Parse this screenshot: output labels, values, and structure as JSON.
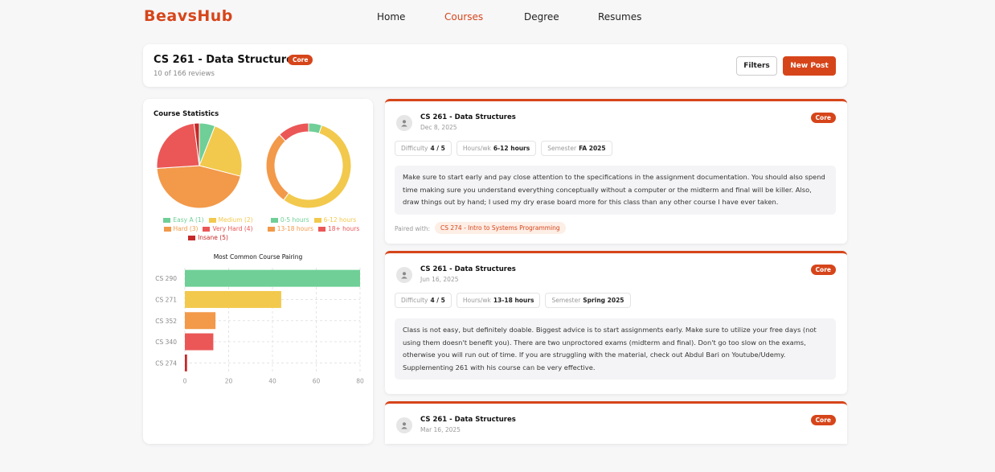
{
  "nav": {
    "brand": "BeavsHub",
    "links": [
      "Home",
      "Courses",
      "Degree",
      "Resumes"
    ],
    "active": "Courses"
  },
  "header": {
    "course_title": "CS 261 - Data Structures",
    "tag": "Core",
    "reviews_count": "10 of 166 reviews",
    "filters_label": "Filters",
    "new_post_label": "New Post"
  },
  "stats": {
    "title": "Course Statistics",
    "difficulty_legend": [
      {
        "label": "Easy A (1)",
        "color": "#6fcf97"
      },
      {
        "label": "Medium (2)",
        "color": "#f2c94c"
      },
      {
        "label": "Hard (3)",
        "color": "#f2994a"
      },
      {
        "label": "Very Hard (4)",
        "color": "#eb5757"
      },
      {
        "label": "Insane (5)",
        "color": "#c62828"
      }
    ],
    "hours_legend": [
      {
        "label": "0-5 hours",
        "color": "#6fcf97"
      },
      {
        "label": "6-12 hours",
        "color": "#f2c94c"
      },
      {
        "label": "13-18 hours",
        "color": "#f2994a"
      },
      {
        "label": "18+ hours",
        "color": "#eb5757"
      }
    ],
    "pairing_title": "Most Common Course Pairing"
  },
  "chart_data": [
    {
      "type": "pie",
      "categories": [
        "Easy A (1)",
        "Medium (2)",
        "Hard (3)",
        "Very Hard (4)",
        "Insane (5)"
      ],
      "values": [
        6,
        23,
        45,
        24,
        2
      ],
      "colors": [
        "#6fcf97",
        "#f2c94c",
        "#f2994a",
        "#eb5757",
        "#c62828"
      ]
    },
    {
      "type": "pie",
      "categories": [
        "0-5 hours",
        "6-12 hours",
        "13-18 hours",
        "18+ hours"
      ],
      "values": [
        5,
        55,
        28,
        12
      ],
      "colors": [
        "#6fcf97",
        "#f2c94c",
        "#f2994a",
        "#eb5757"
      ]
    },
    {
      "type": "bar",
      "orientation": "horizontal",
      "title": "Most Common Course Pairing",
      "categories": [
        "CS 290",
        "CS 271",
        "CS 352",
        "CS 340",
        "CS 274"
      ],
      "values": [
        80,
        44,
        14,
        13,
        1
      ],
      "colors": [
        "#6fcf97",
        "#f2c94c",
        "#f2994a",
        "#eb5757",
        "#c62828"
      ],
      "xticks": [
        0,
        20,
        40,
        60,
        80
      ],
      "xlim": [
        0,
        80
      ],
      "grid": true
    }
  ],
  "reviews": [
    {
      "title": "CS 261 - Data Structures",
      "date": "Dec 8, 2025",
      "tag": "Core",
      "difficulty_label": "Difficulty",
      "difficulty": "4 / 5",
      "hours_label": "Hours/wk",
      "hours": "6-12 hours",
      "semester_label": "Semester",
      "semester": "FA 2025",
      "text": "Make sure to start early and pay close attention to the specifications in the assignment documentation. You should also spend time making sure you understand everything conceptually without a computer or the midterm and final will be killer. Also, draw things out by hand; I used my dry erase board more for this class than any other course I have ever taken.",
      "paired_label": "Paired with:",
      "paired": "CS 274 - Intro to Systems Programming"
    },
    {
      "title": "CS 261 - Data Structures",
      "date": "Jun 16, 2025",
      "tag": "Core",
      "difficulty_label": "Difficulty",
      "difficulty": "4 / 5",
      "hours_label": "Hours/wk",
      "hours": "13-18 hours",
      "semester_label": "Semester",
      "semester": "Spring 2025",
      "text": "Class is not easy, but definitely doable. Biggest advice is to start assignments early. Make sure to utilize your free days (not using them doesn't benefit you). There are two unproctored exams (midterm and final). Don't go too slow on the exams, otherwise you will run out of time. If you are struggling with the material, check out Abdul Bari on Youtube/Udemy. Supplementing 261 with his course can be very effective."
    },
    {
      "title": "CS 261 - Data Structures",
      "date": "Mar 16, 2025",
      "tag": "Core"
    }
  ]
}
